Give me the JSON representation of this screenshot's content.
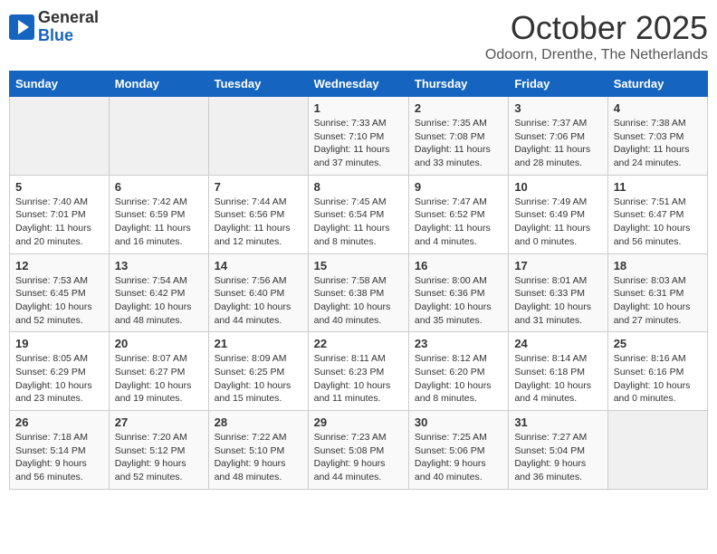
{
  "header": {
    "logo": {
      "general": "General",
      "blue": "Blue"
    },
    "title": "October 2025",
    "location": "Odoorn, Drenthe, The Netherlands"
  },
  "weekdays": [
    "Sunday",
    "Monday",
    "Tuesday",
    "Wednesday",
    "Thursday",
    "Friday",
    "Saturday"
  ],
  "weeks": [
    [
      {
        "day": "",
        "info": ""
      },
      {
        "day": "",
        "info": ""
      },
      {
        "day": "",
        "info": ""
      },
      {
        "day": "1",
        "info": "Sunrise: 7:33 AM\nSunset: 7:10 PM\nDaylight: 11 hours\nand 37 minutes."
      },
      {
        "day": "2",
        "info": "Sunrise: 7:35 AM\nSunset: 7:08 PM\nDaylight: 11 hours\nand 33 minutes."
      },
      {
        "day": "3",
        "info": "Sunrise: 7:37 AM\nSunset: 7:06 PM\nDaylight: 11 hours\nand 28 minutes."
      },
      {
        "day": "4",
        "info": "Sunrise: 7:38 AM\nSunset: 7:03 PM\nDaylight: 11 hours\nand 24 minutes."
      }
    ],
    [
      {
        "day": "5",
        "info": "Sunrise: 7:40 AM\nSunset: 7:01 PM\nDaylight: 11 hours\nand 20 minutes."
      },
      {
        "day": "6",
        "info": "Sunrise: 7:42 AM\nSunset: 6:59 PM\nDaylight: 11 hours\nand 16 minutes."
      },
      {
        "day": "7",
        "info": "Sunrise: 7:44 AM\nSunset: 6:56 PM\nDaylight: 11 hours\nand 12 minutes."
      },
      {
        "day": "8",
        "info": "Sunrise: 7:45 AM\nSunset: 6:54 PM\nDaylight: 11 hours\nand 8 minutes."
      },
      {
        "day": "9",
        "info": "Sunrise: 7:47 AM\nSunset: 6:52 PM\nDaylight: 11 hours\nand 4 minutes."
      },
      {
        "day": "10",
        "info": "Sunrise: 7:49 AM\nSunset: 6:49 PM\nDaylight: 11 hours\nand 0 minutes."
      },
      {
        "day": "11",
        "info": "Sunrise: 7:51 AM\nSunset: 6:47 PM\nDaylight: 10 hours\nand 56 minutes."
      }
    ],
    [
      {
        "day": "12",
        "info": "Sunrise: 7:53 AM\nSunset: 6:45 PM\nDaylight: 10 hours\nand 52 minutes."
      },
      {
        "day": "13",
        "info": "Sunrise: 7:54 AM\nSunset: 6:42 PM\nDaylight: 10 hours\nand 48 minutes."
      },
      {
        "day": "14",
        "info": "Sunrise: 7:56 AM\nSunset: 6:40 PM\nDaylight: 10 hours\nand 44 minutes."
      },
      {
        "day": "15",
        "info": "Sunrise: 7:58 AM\nSunset: 6:38 PM\nDaylight: 10 hours\nand 40 minutes."
      },
      {
        "day": "16",
        "info": "Sunrise: 8:00 AM\nSunset: 6:36 PM\nDaylight: 10 hours\nand 35 minutes."
      },
      {
        "day": "17",
        "info": "Sunrise: 8:01 AM\nSunset: 6:33 PM\nDaylight: 10 hours\nand 31 minutes."
      },
      {
        "day": "18",
        "info": "Sunrise: 8:03 AM\nSunset: 6:31 PM\nDaylight: 10 hours\nand 27 minutes."
      }
    ],
    [
      {
        "day": "19",
        "info": "Sunrise: 8:05 AM\nSunset: 6:29 PM\nDaylight: 10 hours\nand 23 minutes."
      },
      {
        "day": "20",
        "info": "Sunrise: 8:07 AM\nSunset: 6:27 PM\nDaylight: 10 hours\nand 19 minutes."
      },
      {
        "day": "21",
        "info": "Sunrise: 8:09 AM\nSunset: 6:25 PM\nDaylight: 10 hours\nand 15 minutes."
      },
      {
        "day": "22",
        "info": "Sunrise: 8:11 AM\nSunset: 6:23 PM\nDaylight: 10 hours\nand 11 minutes."
      },
      {
        "day": "23",
        "info": "Sunrise: 8:12 AM\nSunset: 6:20 PM\nDaylight: 10 hours\nand 8 minutes."
      },
      {
        "day": "24",
        "info": "Sunrise: 8:14 AM\nSunset: 6:18 PM\nDaylight: 10 hours\nand 4 minutes."
      },
      {
        "day": "25",
        "info": "Sunrise: 8:16 AM\nSunset: 6:16 PM\nDaylight: 10 hours\nand 0 minutes."
      }
    ],
    [
      {
        "day": "26",
        "info": "Sunrise: 7:18 AM\nSunset: 5:14 PM\nDaylight: 9 hours\nand 56 minutes."
      },
      {
        "day": "27",
        "info": "Sunrise: 7:20 AM\nSunset: 5:12 PM\nDaylight: 9 hours\nand 52 minutes."
      },
      {
        "day": "28",
        "info": "Sunrise: 7:22 AM\nSunset: 5:10 PM\nDaylight: 9 hours\nand 48 minutes."
      },
      {
        "day": "29",
        "info": "Sunrise: 7:23 AM\nSunset: 5:08 PM\nDaylight: 9 hours\nand 44 minutes."
      },
      {
        "day": "30",
        "info": "Sunrise: 7:25 AM\nSunset: 5:06 PM\nDaylight: 9 hours\nand 40 minutes."
      },
      {
        "day": "31",
        "info": "Sunrise: 7:27 AM\nSunset: 5:04 PM\nDaylight: 9 hours\nand 36 minutes."
      },
      {
        "day": "",
        "info": ""
      }
    ]
  ]
}
